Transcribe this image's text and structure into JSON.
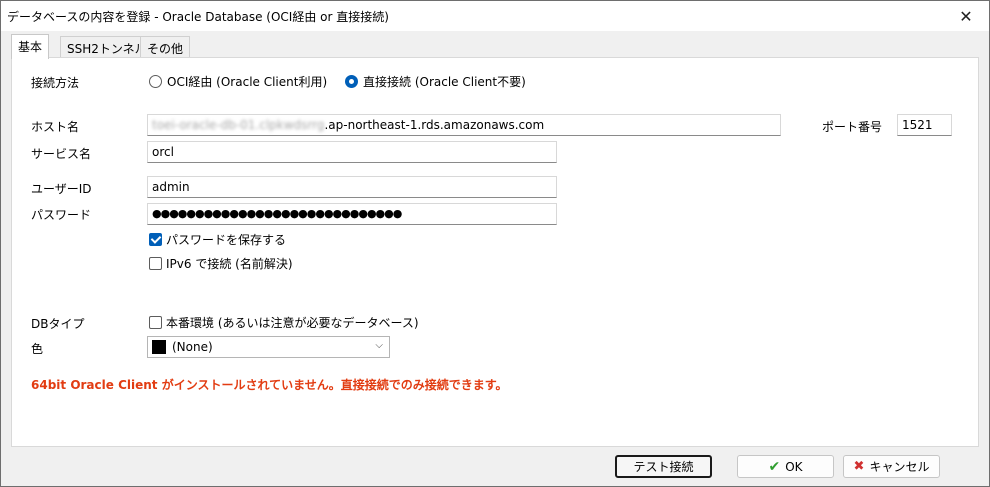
{
  "window": {
    "title": "データベースの内容を登録 - Oracle Database (OCI経由 or 直接接続)",
    "close_icon": "close-icon"
  },
  "tabs": [
    {
      "label": "基本",
      "active": true
    },
    {
      "label": "SSH2トンネル",
      "active": false
    },
    {
      "label": "その他",
      "active": false
    }
  ],
  "form": {
    "connection_method_label": "接続方法",
    "radio_oci": "OCI経由 (Oracle Client利用)",
    "radio_direct": "直接接続 (Oracle Client不要)",
    "selected_method": "direct",
    "host_label": "ホスト名",
    "host_value_blurred": "toei-oracle-db-01.clpkwdsrrg",
    "host_value_visible": ".ap-northeast-1.rds.amazonaws.com",
    "port_label": "ポート番号",
    "port_value": "1521",
    "service_label": "サービス名",
    "service_value": "orcl",
    "user_label": "ユーザーID",
    "user_value": "admin",
    "password_label": "パスワード",
    "password_value": "●●●●●●●●●●●●●●●●●●●●●●●●●●●●●",
    "save_password_label": "パスワードを保存する",
    "save_password_checked": true,
    "ipv6_label": "IPv6 で接続 (名前解決)",
    "ipv6_checked": false,
    "dbtype_label": "DBタイプ",
    "production_label": "本番環境 (あるいは注意が必要なデータベース)",
    "production_checked": false,
    "color_label": "色",
    "color_value": "(None)",
    "color_swatch": "#000000"
  },
  "warning": "64bit Oracle Client がインストールされていません。直接接続でのみ接続できます。",
  "warning_color": "#e23c12",
  "buttons": {
    "test": "テスト接続",
    "ok": "OK",
    "cancel": "キャンセル"
  }
}
